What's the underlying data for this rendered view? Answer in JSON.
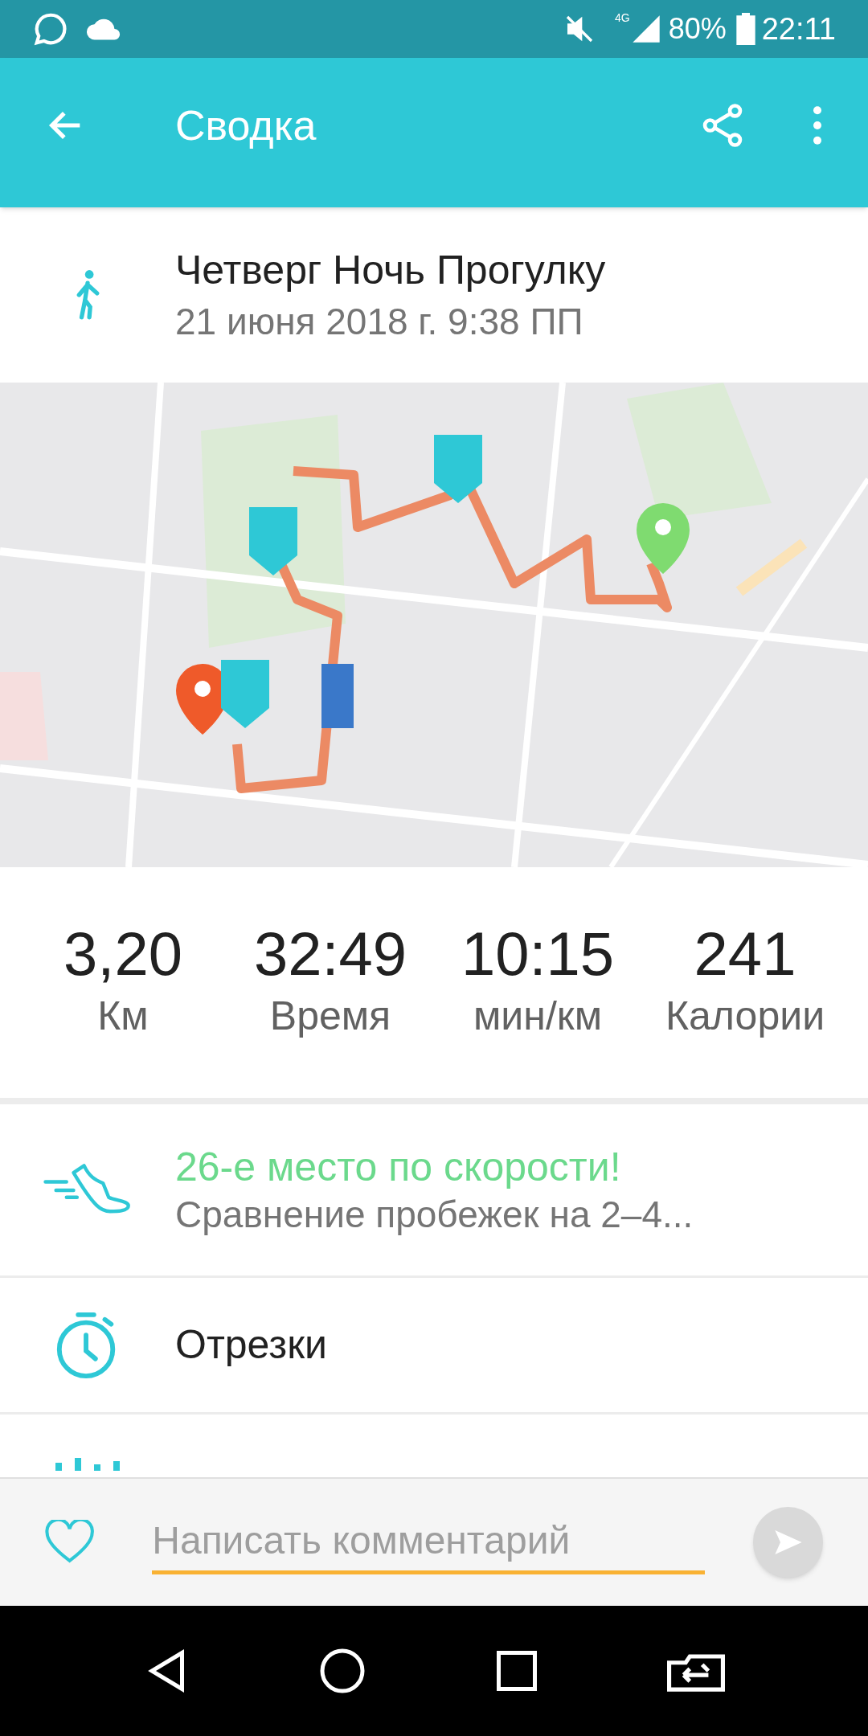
{
  "status_bar": {
    "battery": "80%",
    "network": "4G",
    "time": "22:11"
  },
  "app_bar": {
    "title": "Сводка"
  },
  "activity": {
    "title": "Четверг Ночь Прогулку",
    "date": "21 июня 2018 г. 9:38 ПП"
  },
  "stats": [
    {
      "value": "3,20",
      "label": "Км"
    },
    {
      "value": "32:49",
      "label": "Время"
    },
    {
      "value": "10:15",
      "label": "мин/км"
    },
    {
      "value": "241",
      "label": "Калории"
    }
  ],
  "items": [
    {
      "kind": "ranking",
      "title": "26-е место по скорости!",
      "subtitle": "Сравнение пробежек на 2–4..."
    },
    {
      "kind": "splits",
      "title": "Отрезки"
    }
  ],
  "comment": {
    "placeholder": "Написать комментарий"
  }
}
